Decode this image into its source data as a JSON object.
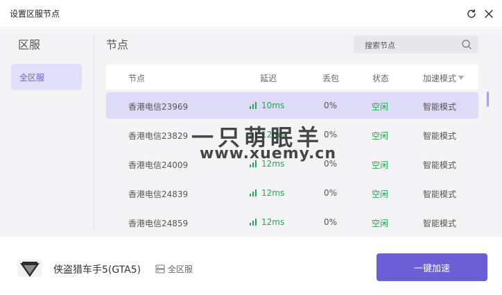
{
  "window": {
    "title": "设置区服节点"
  },
  "sidebar": {
    "title": "区服",
    "items": [
      {
        "label": "全区服",
        "selected": true
      }
    ]
  },
  "nodes": {
    "title": "节点",
    "search": {
      "placeholder": "搜索节点"
    },
    "columns": {
      "node": "节点",
      "latency": "延迟",
      "loss": "丢包",
      "status": "状态",
      "mode": "加速模式"
    },
    "rows": [
      {
        "name": "香港电信23969",
        "latency": "10ms",
        "loss": "0%",
        "status": "空闲",
        "mode": "智能模式",
        "selected": true
      },
      {
        "name": "香港电信23829",
        "latency": "12ms",
        "loss": "0%",
        "status": "空闲",
        "mode": "智能模式",
        "selected": false
      },
      {
        "name": "香港电信24009",
        "latency": "12ms",
        "loss": "0%",
        "status": "空闲",
        "mode": "智能模式",
        "selected": false
      },
      {
        "name": "香港电信24839",
        "latency": "12ms",
        "loss": "0%",
        "status": "空闲",
        "mode": "智能模式",
        "selected": false
      },
      {
        "name": "香港电信24859",
        "latency": "12ms",
        "loss": "0%",
        "status": "空闲",
        "mode": "智能模式",
        "selected": false
      }
    ]
  },
  "watermark": {
    "line1": "一只萌眠羊",
    "line2": "www.xuemy.cn"
  },
  "footer": {
    "game_name": "侠盗猎车手5(GTA5)",
    "region_label": "全区服",
    "accelerate_button": "一键加速"
  },
  "colors": {
    "accent": "#6b5fd6",
    "selected_row": "#dedbf9",
    "good": "#1fa84c"
  },
  "icons": {
    "refresh": "refresh-icon",
    "close": "close-icon",
    "search": "search-icon",
    "signal": "signal-icon",
    "region": "server-icon",
    "game": "gta5-logo"
  }
}
